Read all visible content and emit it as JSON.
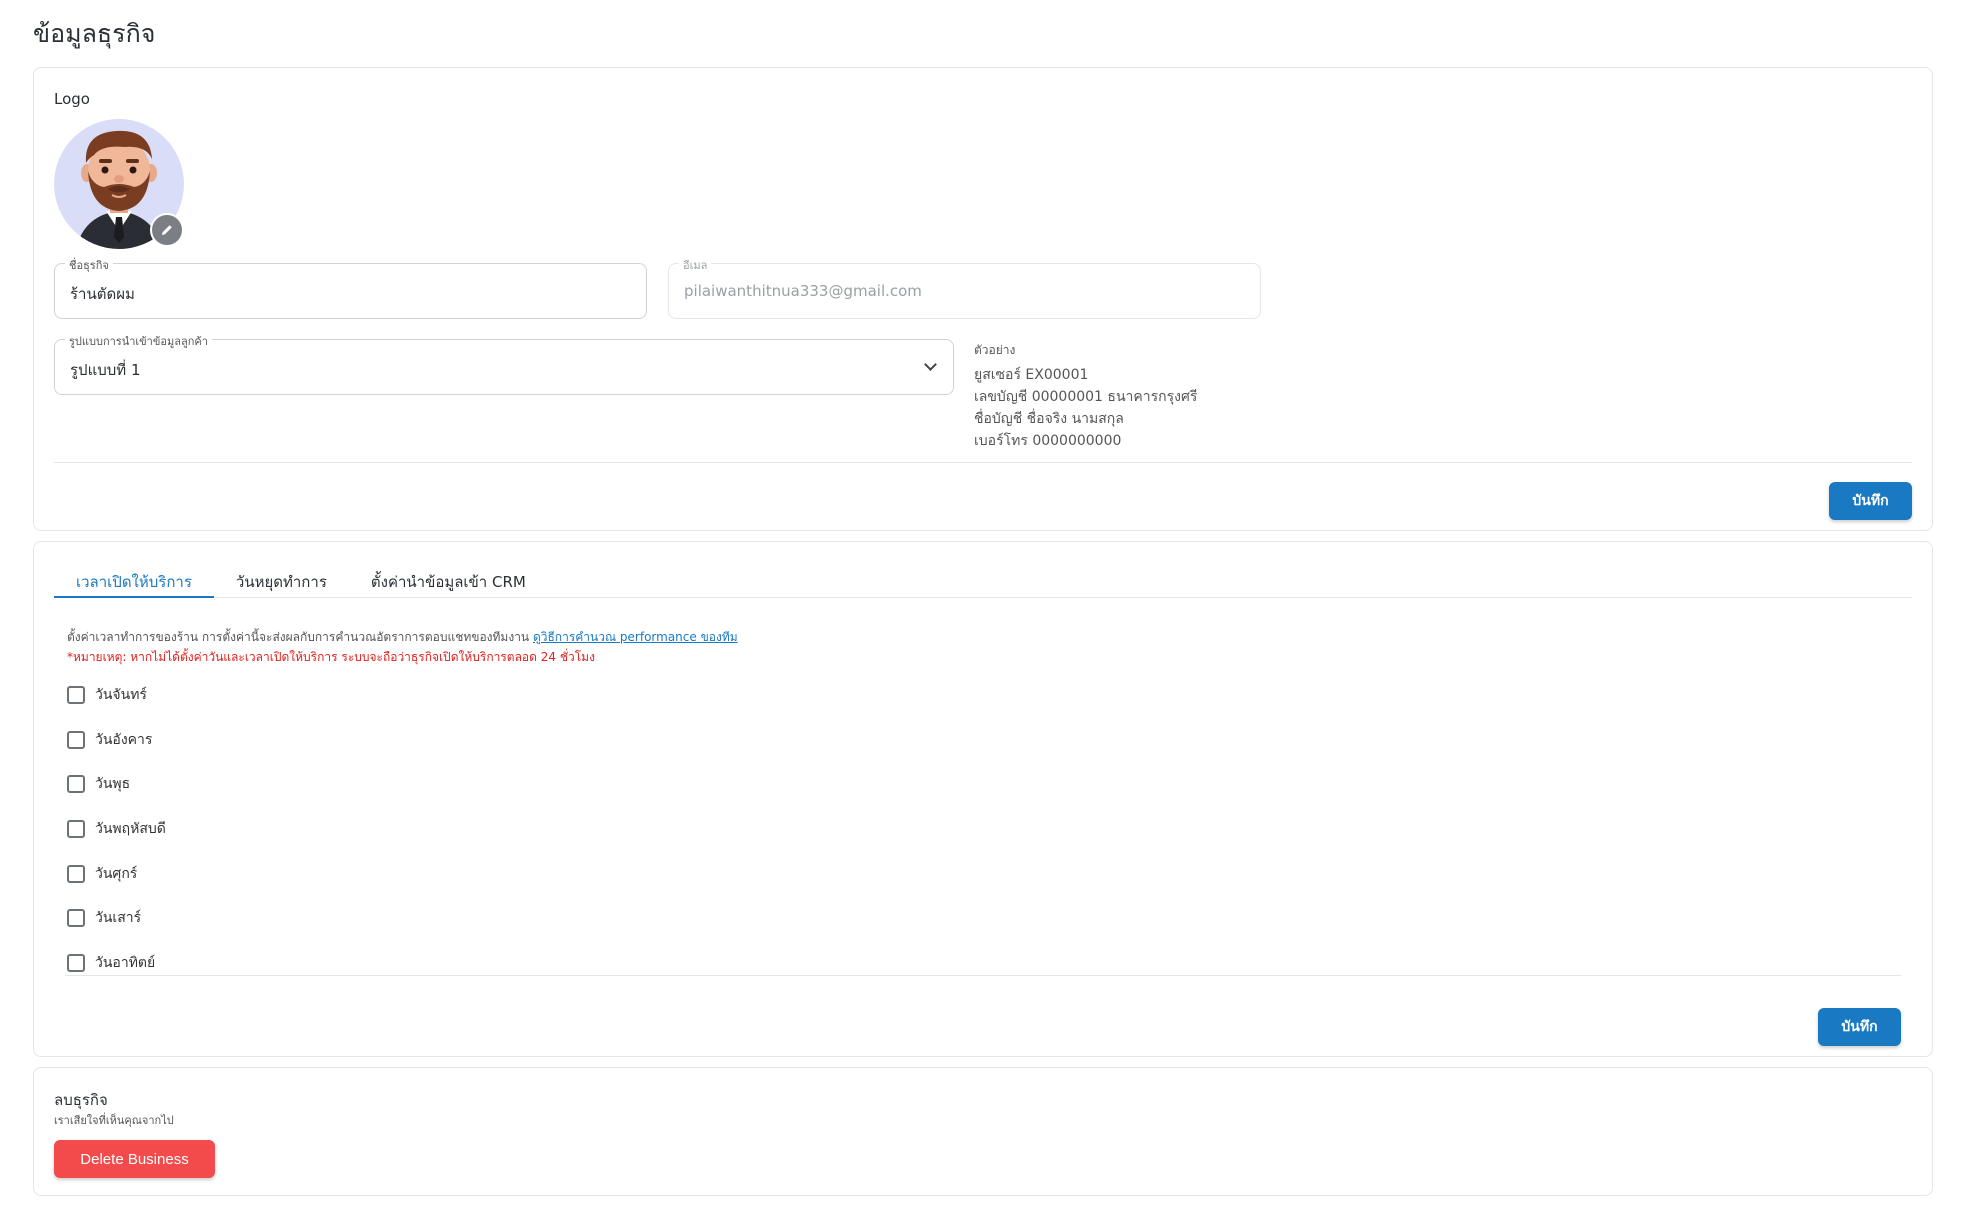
{
  "page": {
    "title": "ข้อมูลธุรกิจ"
  },
  "info": {
    "logo_label": "Logo",
    "name": {
      "label": "ชื่อธุรกิจ",
      "value": "ร้านตัดผม"
    },
    "email": {
      "label": "อีเมล",
      "value": "pilaiwanthitnua333@gmail.com"
    },
    "format": {
      "label": "รูปแบบการนำเข้าข้อมูลลูกค้า",
      "value": "รูปแบบที่ 1"
    },
    "example": {
      "title": "ตัวอย่าง",
      "lines": [
        "ยูสเซอร์ EX00001",
        "เลขบัญชี 00000001 ธนาคารกรุงศรี",
        "ชื่อบัญชี ชื่อจริง นามสกุล",
        "เบอร์โทร 0000000000"
      ]
    },
    "save_label": "บันทึก"
  },
  "hours": {
    "tabs": [
      {
        "label": "เวลาเปิดให้บริการ",
        "active": true
      },
      {
        "label": "วันหยุดทำการ",
        "active": false
      },
      {
        "label": "ตั้งค่านำข้อมูลเข้า CRM",
        "active": false
      }
    ],
    "hint_text": "ตั้งค่าเวลาทำการของร้าน การตั้งค่านี้จะส่งผลกับการคำนวณอัตราการตอบแชทของทีมงาน ",
    "hint_link": "ดูวิธีการคำนวณ performance ของทีม",
    "note": "*หมายเหตุ: หากไม่ได้ตั้งค่าวันและเวลาเปิดให้บริการ ระบบจะถือว่าธุรกิจเปิดให้บริการตลอด 24 ชั่วโมง",
    "days": [
      "วันจันทร์",
      "วันอังคาร",
      "วันพุธ",
      "วันพฤหัสบดี",
      "วันศุกร์",
      "วันเสาร์",
      "วันอาทิตย์"
    ],
    "save_label": "บันทึก"
  },
  "delete": {
    "title": "ลบธุรกิจ",
    "subtitle": "เราเสียใจที่เห็นคุณจากไป",
    "button_label": "Delete Business"
  },
  "colors": {
    "primary": "#1979c3",
    "danger": "#f34b4b",
    "note": "#e0201c",
    "avatar_bg": "#d9ddf8"
  }
}
